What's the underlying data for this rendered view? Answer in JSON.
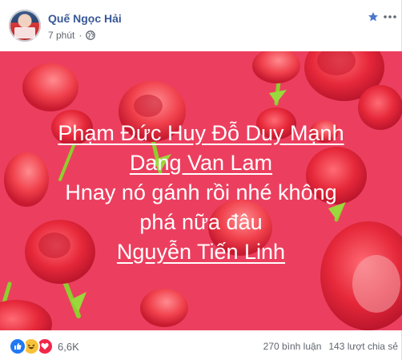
{
  "post": {
    "author": "Quế Ngọc Hải",
    "time": "7 phút",
    "privacy_icon": "globe-icon",
    "lines": [
      {
        "text": "Phạm Đức Huy Đỗ Duy Mạnh",
        "tag": true
      },
      {
        "text": "Dang Van Lam",
        "tag": true
      },
      {
        "text": "Hnay nó gánh rồi nhé không",
        "tag": false
      },
      {
        "text": "phá nữa đâu",
        "tag": false
      },
      {
        "text": "Nguyễn Tiến Linh",
        "tag": true
      }
    ],
    "background_color": "#ec3f5f"
  },
  "footer": {
    "reaction_count": "6,6K",
    "comments": "270 bình luận",
    "shares": "143 lượt chia sẻ"
  },
  "colors": {
    "author_link": "#385898",
    "meta_text": "#606770",
    "like": "#2078f4",
    "haha": "#f7c13a",
    "love": "#f0284a"
  }
}
